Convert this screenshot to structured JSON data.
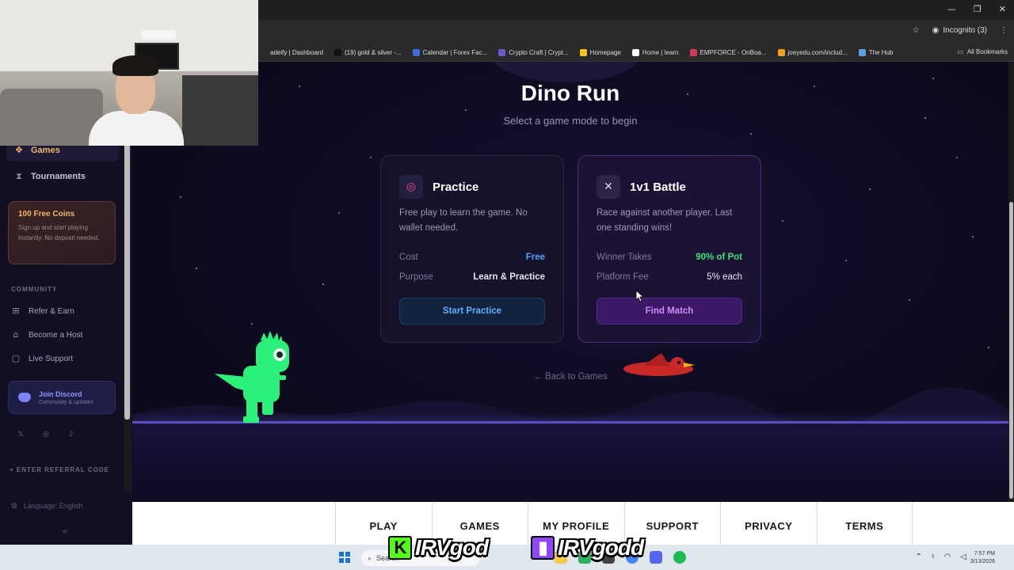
{
  "browser": {
    "incognito_label": "Incognito (3)",
    "bookmarks": [
      {
        "label": "adeify | Dashboard",
        "color": "#2b2b2b"
      },
      {
        "label": "(19) gold & silver -...",
        "color": "#111111"
      },
      {
        "label": "Calendar | Forex Fac...",
        "color": "#3b6bd6"
      },
      {
        "label": "Crypto Craft | Crypt...",
        "color": "#6a5acd"
      },
      {
        "label": "Homepage",
        "color": "#f5c518"
      },
      {
        "label": "Home | learn",
        "color": "#ffffff"
      },
      {
        "label": "EMPFORCE - OnBoa...",
        "color": "#d23c5a"
      },
      {
        "label": "joeyedu.com/includ...",
        "color": "#f0a020"
      },
      {
        "label": "The Hub",
        "color": "#5aa0e0"
      }
    ],
    "all_bookmarks": "All Bookmarks"
  },
  "sidebar": {
    "items": [
      {
        "label": "Games",
        "icon": "gamepad-icon"
      },
      {
        "label": "Tournaments",
        "icon": "trophy-icon"
      }
    ],
    "promo": {
      "title": "100 Free Coins",
      "text": "Sign up and start playing instantly. No deposit needed."
    },
    "community_label": "COMMUNITY",
    "community_links": [
      {
        "label": "Refer & Earn",
        "icon": "gift-icon"
      },
      {
        "label": "Become a Host",
        "icon": "home-icon"
      },
      {
        "label": "Live Support",
        "icon": "chat-icon"
      }
    ],
    "discord": {
      "title": "Join Discord",
      "subtitle": "Community & updates"
    },
    "referral_label": "+ ENTER REFERRAL CODE",
    "language_label": "Language: English",
    "collapse_glyph": "«"
  },
  "game": {
    "title": "Dino Run",
    "subtitle": "Select a game mode to begin",
    "modes": [
      {
        "title": "Practice",
        "icon": "target-icon",
        "description": "Free play to learn the game. No wallet needed.",
        "rows": [
          {
            "key": "Cost",
            "value": "Free"
          },
          {
            "key": "Purpose",
            "value": "Learn & Practice"
          }
        ],
        "button": "Start Practice"
      },
      {
        "title": "1v1 Battle",
        "icon": "crossed-swords-icon",
        "description": "Race against another player. Last one standing wins!",
        "rows": [
          {
            "key": "Winner Takes",
            "value": "90% of Pot"
          },
          {
            "key": "Platform Fee",
            "value": "5% each"
          }
        ],
        "button": "Find Match"
      }
    ],
    "back_link": "← Back to Games"
  },
  "footer_nav": [
    "PLAY",
    "GAMES",
    "MY PROFILE",
    "SUPPORT",
    "PRIVACY",
    "TERMS"
  ],
  "taskbar": {
    "search_placeholder": "Search",
    "time": "7:57 PM",
    "date": "3/13/2026"
  },
  "stream_overlay": {
    "kick_name": "IRVgod",
    "twitch_name": "IRVgodd"
  },
  "colors": {
    "accent_orange": "#f2b86a",
    "practice_blue": "#4aa3ff",
    "battle_green": "#36e07a",
    "battle_purple": "#d08bff",
    "dino_green": "#2bf07a",
    "bird_red": "#c82828"
  }
}
